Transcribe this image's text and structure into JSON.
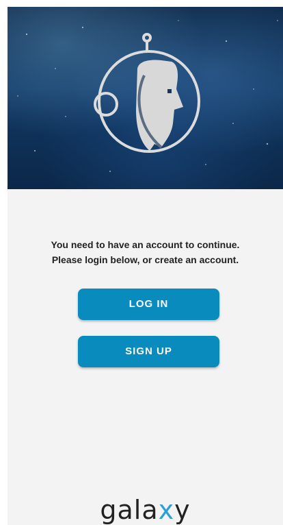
{
  "hero": {
    "logo_icon": "astronaut-helmet-logo-icon"
  },
  "message": {
    "line1": "You need to have an account to continue.",
    "line2": "Please login below, or create an account."
  },
  "actions": {
    "login_label": "LOG IN",
    "signup_label": "SIGN UP"
  },
  "brand": {
    "name": "galaxy",
    "name_dark": "gala",
    "name_accent": "x",
    "name_end": "y"
  },
  "colors": {
    "accent": "#0a8bbd",
    "background": "#f3f3f3",
    "brand_accent": "#2aa0d8"
  }
}
